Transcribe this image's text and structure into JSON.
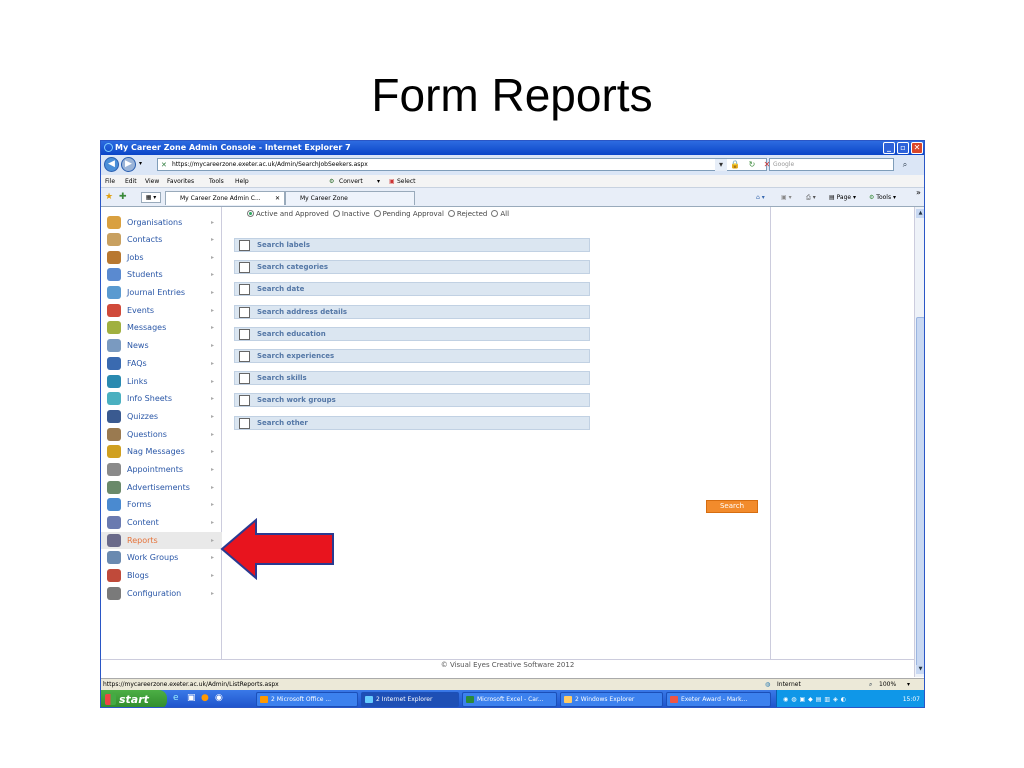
{
  "slide": {
    "title": "Form Reports"
  },
  "window": {
    "title": "My Career Zone Admin Console - Internet Explorer 7"
  },
  "address": {
    "url": "https://mycareerzone.exeter.ac.uk/Admin/SearchJobSeekers.aspx",
    "search_placeholder": "Google"
  },
  "menu": [
    "File",
    "Edit",
    "View",
    "Favorites",
    "Tools",
    "Help"
  ],
  "toolbar": {
    "convert_label": "Convert",
    "select_label": "Select",
    "page_label": "Page",
    "tools_label": "Tools"
  },
  "tabs": [
    {
      "label": "My Career Zone Admin C..."
    },
    {
      "label": "My Career Zone"
    }
  ],
  "sidebar": {
    "items": [
      {
        "label": "Organisations",
        "icon": "buildings-icon",
        "color": "#d9a040"
      },
      {
        "label": "Contacts",
        "icon": "contact-card-icon",
        "color": "#c8a060"
      },
      {
        "label": "Jobs",
        "icon": "briefcase-icon",
        "color": "#b87830"
      },
      {
        "label": "Students",
        "icon": "people-icon",
        "color": "#5a8ad0"
      },
      {
        "label": "Journal Entries",
        "icon": "journal-icon",
        "color": "#5a9ad0"
      },
      {
        "label": "Events",
        "icon": "events-icon",
        "color": "#d04a3a"
      },
      {
        "label": "Messages",
        "icon": "messages-icon",
        "color": "#a0b040"
      },
      {
        "label": "News",
        "icon": "news-icon",
        "color": "#7a9ac0"
      },
      {
        "label": "FAQs",
        "icon": "faq-icon",
        "color": "#3a6ab0"
      },
      {
        "label": "Links",
        "icon": "link-globe-icon",
        "color": "#2a8ab0"
      },
      {
        "label": "Info Sheets",
        "icon": "info-sheets-icon",
        "color": "#4ab0c0"
      },
      {
        "label": "Quizzes",
        "icon": "quiz-icon",
        "color": "#3a5a90"
      },
      {
        "label": "Questions",
        "icon": "questions-icon",
        "color": "#9a7a50"
      },
      {
        "label": "Nag Messages",
        "icon": "nag-icon",
        "color": "#d0a020"
      },
      {
        "label": "Appointments",
        "icon": "appointments-icon",
        "color": "#8a8a8a"
      },
      {
        "label": "Advertisements",
        "icon": "advertisements-icon",
        "color": "#6a8a6a"
      },
      {
        "label": "Forms",
        "icon": "forms-icon",
        "color": "#4a8ad0"
      },
      {
        "label": "Content",
        "icon": "content-icon",
        "color": "#6a7ab0"
      },
      {
        "label": "Reports",
        "icon": "reports-icon",
        "color": "#6a6a8a"
      },
      {
        "label": "Work Groups",
        "icon": "work-groups-icon",
        "color": "#6a8ab0"
      },
      {
        "label": "Blogs",
        "icon": "blogs-icon",
        "color": "#c04a3a"
      },
      {
        "label": "Configuration",
        "icon": "configuration-icon",
        "color": "#7a7a7a"
      }
    ],
    "active_index": 18
  },
  "status_filter": {
    "options": [
      "Active and Approved",
      "Inactive",
      "Pending Approval",
      "Rejected",
      "All"
    ],
    "selected": "Active and Approved"
  },
  "search_sections": [
    "Search labels",
    "Search categories",
    "Search date",
    "Search address details",
    "Search education",
    "Search experiences",
    "Search skills",
    "Search work groups",
    "Search other"
  ],
  "search_button": "Search",
  "footer": {
    "copyright": "© Visual Eyes Creative Software 2012"
  },
  "statusbar": {
    "url": "https://mycareerzone.exeter.ac.uk/Admin/ListReports.aspx",
    "zone": "Internet",
    "zoom": "100%"
  },
  "taskbar": {
    "start": "start",
    "items": [
      "2 Microsoft Office ...",
      "2 Internet Explorer",
      "Microsoft Excel - Car...",
      "2 Windows Explorer",
      "Exeter Award - Mark..."
    ],
    "clock": "15:07"
  },
  "colors": {
    "annotation_arrow": "#e8141e",
    "search_button": "#f28b2c",
    "active_link": "#e6733a"
  }
}
